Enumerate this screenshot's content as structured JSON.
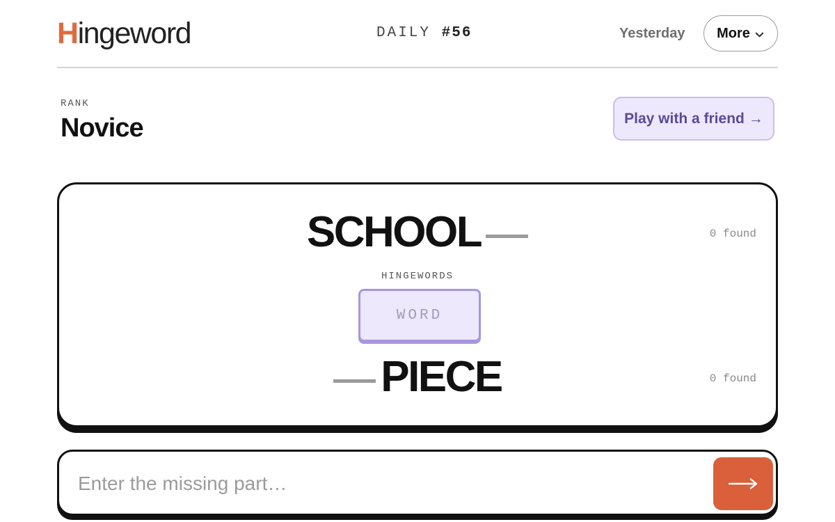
{
  "header": {
    "logo": {
      "initial": "H",
      "rest": "ingeword"
    },
    "daily_label": "DAILY",
    "daily_number": "#56",
    "yesterday_label": "Yesterday",
    "more_label": "More",
    "more_icon": "chevron-down-icon"
  },
  "rank": {
    "label": "RANK",
    "value": "Novice"
  },
  "friend_button": {
    "label": "Play with a friend",
    "arrow": "→"
  },
  "puzzle": {
    "top_word": "SCHOOL",
    "top_found": "0 found",
    "hinge_label": "HINGEWORDS",
    "hinge_placeholder": "WORD",
    "bottom_word": "PIECE",
    "bottom_found": "0 found"
  },
  "answer": {
    "placeholder": "Enter the missing part…",
    "value": "",
    "submit_icon": "arrow-right-icon"
  },
  "colors": {
    "brand_orange": "#d9603a",
    "accent_purple": "#5b4a96",
    "lavender_fill": "#ede8fb",
    "lavender_border": "#a796de"
  }
}
